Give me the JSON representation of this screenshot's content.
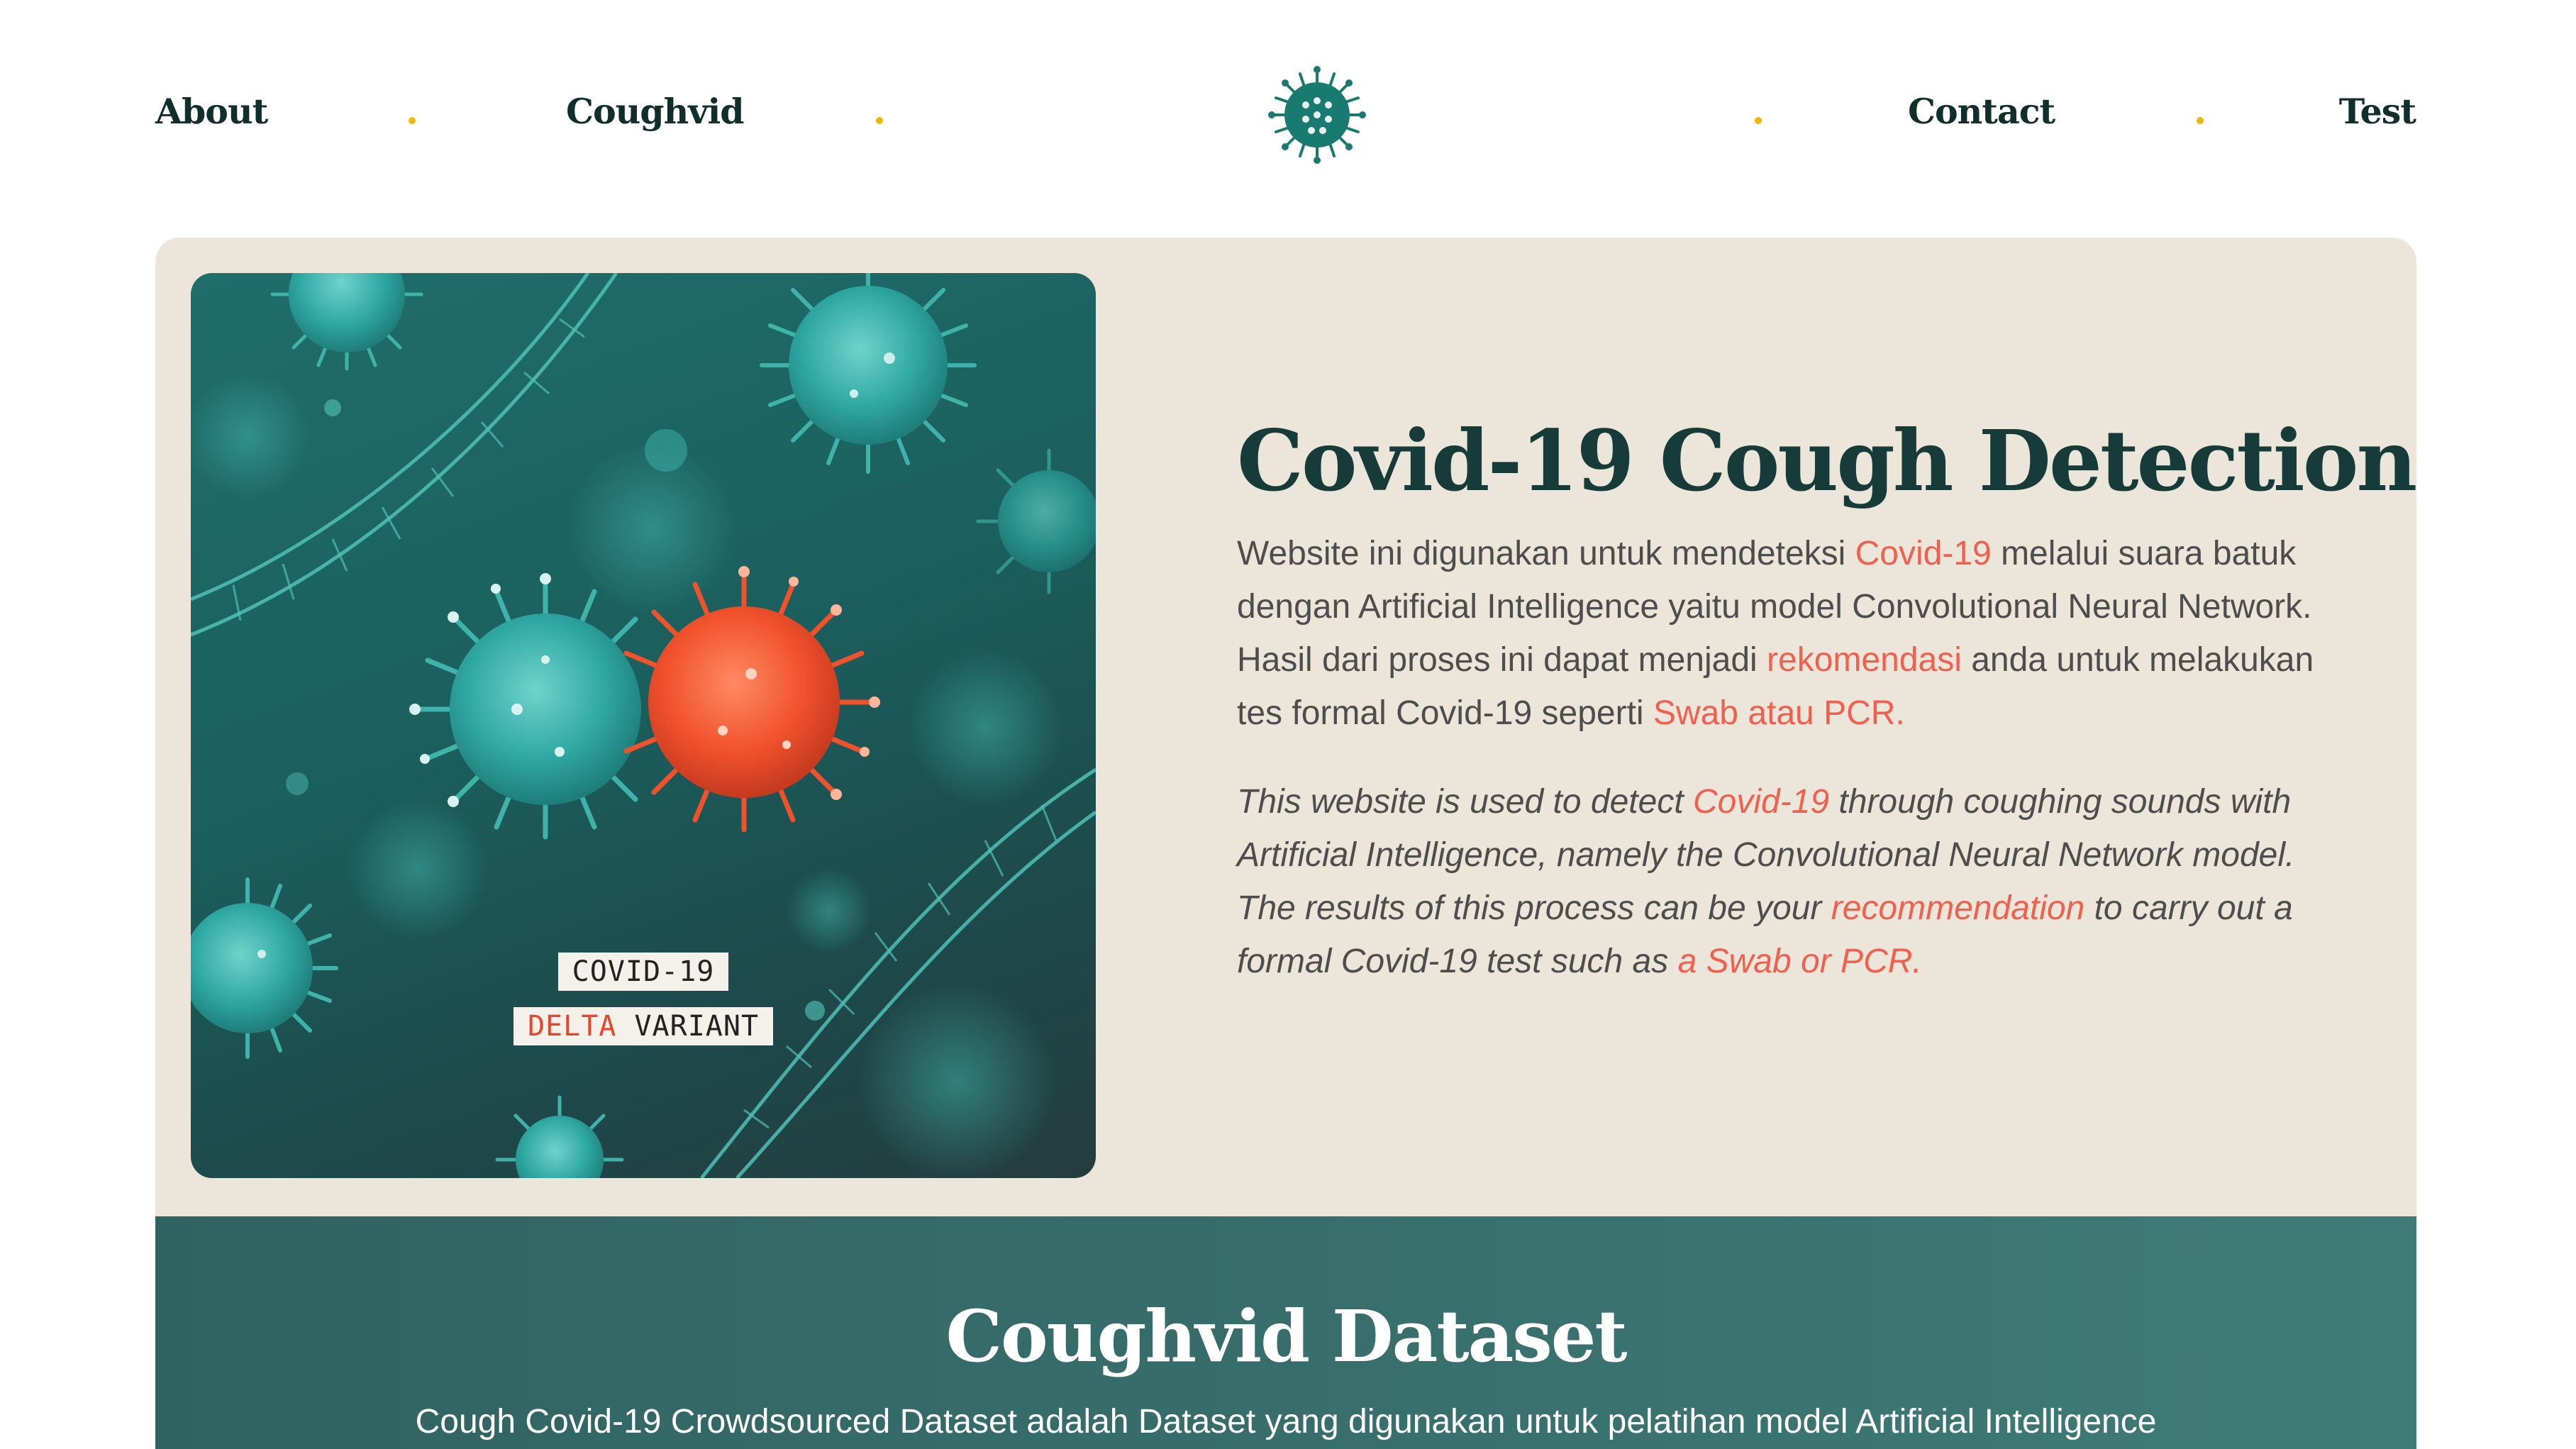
{
  "nav": {
    "about": "About",
    "coughvid": "Coughvid",
    "contact": "Contact",
    "test": "Test",
    "logo_icon": "virus-icon"
  },
  "colors": {
    "accent_dot": "#f2b705",
    "title_dark": "#173b38",
    "highlight": "#f0604d",
    "hero_bg": "#ebe5da",
    "dataset_bg": "#376e6b",
    "logo": "#197a72"
  },
  "hero": {
    "image": {
      "label_line1": "COVID-19",
      "label_line2_red": "DELTA",
      "label_line2_rest": " VARIANT"
    },
    "title": "Covid-19 Cough Detection",
    "id": {
      "t1": "Website ini digunakan untuk mendeteksi ",
      "h1": "Covid-19",
      "t2": " melalui suara batuk dengan Artificial Intelligence yaitu model Convolutional Neural Network. Hasil dari proses ini dapat menjadi ",
      "h2": "rekomendasi",
      "t3": " anda untuk melakukan tes formal Covid-19 seperti ",
      "h3": "Swab atau PCR."
    },
    "en": {
      "t1": "This website is used to detect ",
      "h1": "Covid-19",
      "t2": " through coughing sounds with Artificial Intelligence, namely the Convolutional Neural Network model. The results of this process can be your ",
      "h2": "recommendation",
      "t3": " to carry out a formal Covid-19 test such as ",
      "h3": "a Swab or PCR."
    }
  },
  "dataset": {
    "title": "Coughvid Dataset",
    "description": "Cough Covid-19 Crowdsourced Dataset adalah Dataset yang digunakan untuk pelatihan model Artificial Intelligence"
  }
}
